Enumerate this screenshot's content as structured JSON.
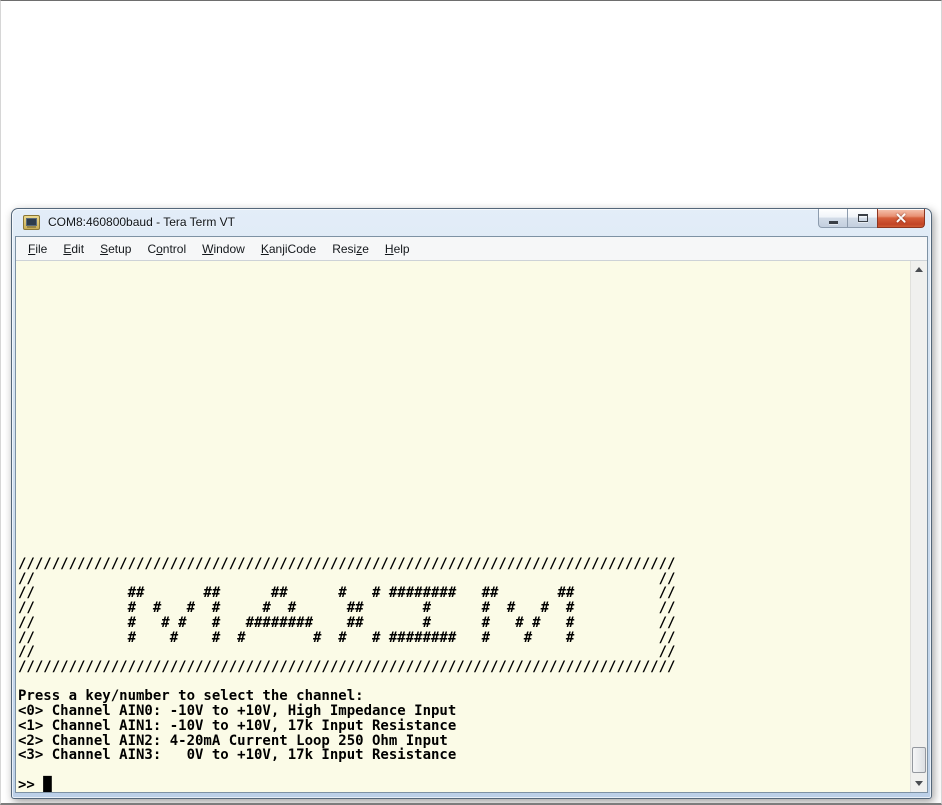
{
  "window": {
    "title": "COM8:460800baud - Tera Term VT",
    "colors": {
      "frame": "#C5D7EC",
      "close_button": "#C7492B",
      "terminal_background": "#FBFBE7",
      "terminal_text": "#000000"
    }
  },
  "menu": {
    "items": [
      {
        "pre": "",
        "mn": "F",
        "post": "ile"
      },
      {
        "pre": "",
        "mn": "E",
        "post": "dit"
      },
      {
        "pre": "",
        "mn": "S",
        "post": "etup"
      },
      {
        "pre": "C",
        "mn": "o",
        "post": "ntrol"
      },
      {
        "pre": "",
        "mn": "W",
        "post": "indow"
      },
      {
        "pre": "",
        "mn": "K",
        "post": "anjiCode"
      },
      {
        "pre": "Resi",
        "mn": "z",
        "post": "e"
      },
      {
        "pre": "",
        "mn": "H",
        "post": "elp"
      }
    ]
  },
  "terminal": {
    "lines": [
      "",
      "",
      "",
      "",
      "",
      "",
      "",
      "",
      "",
      "",
      "",
      "",
      "",
      "",
      "",
      "",
      "",
      "",
      "",
      "",
      "//////////////////////////////////////////////////////////////////////////////",
      "//                                                                          //",
      "//           ##       ##      ##      #   # ########   ##       ##          //",
      "//           #  #   #  #     #  #      ##       #      #  #   #  #          //",
      "//           #   # #   #   ########    ##       #      #   # #   #          //",
      "//           #    #    #  #        #  #   # ########   #    #    #          //",
      "//                                                                          //",
      "//////////////////////////////////////////////////////////////////////////////",
      "",
      "Press a key/number to select the channel:",
      "<0> Channel AIN0: -10V to +10V, High Impedance Input",
      "<1> Channel AIN1: -10V to +10V, 17k Input Resistance",
      "<2> Channel AIN2: 4-20mA Current Loop 250 Ohm Input",
      "<3> Channel AIN3:   0V to +10V, 17k Input Resistance",
      "",
      ">> █"
    ]
  }
}
